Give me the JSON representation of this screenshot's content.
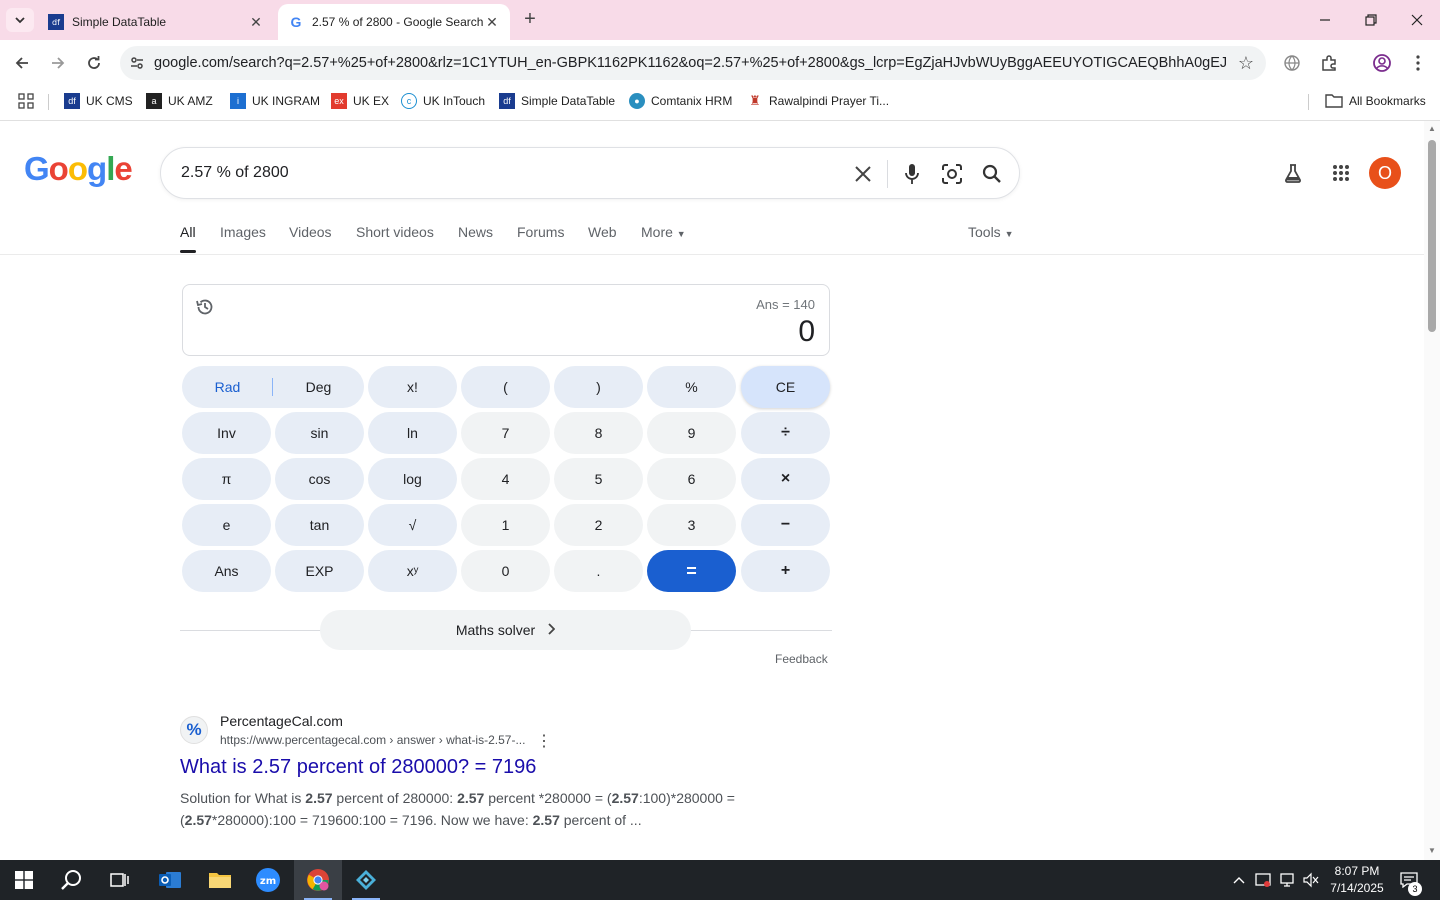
{
  "browser": {
    "tabs": [
      {
        "title": "Simple DataTable",
        "active": false,
        "favicon": "df-icon"
      },
      {
        "title": "2.57 % of 2800 - Google Search",
        "active": true,
        "favicon": "google-icon"
      }
    ],
    "url": "google.com/search?q=2.57+%25+of+2800&rlz=1C1YTUH_en-GBPK1162PK1162&oq=2.57+%25+of+2800&gs_lcrp=EgZjaHJvbWUyBggAEEUYOTIGCAEQBhhA0gEJMjgyM...",
    "bookmarks": [
      "UK CMS",
      "UK AMZ",
      "UK INGRAM",
      "UK EX",
      "UK InTouch",
      "Simple DataTable",
      "Comtanix HRM",
      "Rawalpindi Prayer Ti..."
    ],
    "all_bookmarks": "All Bookmarks"
  },
  "google": {
    "logo": [
      "G",
      "o",
      "o",
      "g",
      "l",
      "e"
    ],
    "query": "2.57 % of 2800",
    "avatar_letter": "O",
    "tabs": [
      "All",
      "Images",
      "Videos",
      "Short videos",
      "News",
      "Forums",
      "Web",
      "More"
    ],
    "tools": "Tools"
  },
  "calculator": {
    "ans": "Ans = 140",
    "value": "0",
    "rad": "Rad",
    "deg": "Deg",
    "keys": [
      [
        "x!",
        "(",
        ")",
        "%",
        "CE"
      ],
      [
        "Inv",
        "sin",
        "ln",
        "7",
        "8",
        "9",
        "÷"
      ],
      [
        "π",
        "cos",
        "log",
        "4",
        "5",
        "6",
        "×"
      ],
      [
        "e",
        "tan",
        "√",
        "1",
        "2",
        "3",
        "−"
      ],
      [
        "Ans",
        "EXP",
        "xʸ",
        "0",
        ".",
        "=",
        "+"
      ]
    ],
    "solver": "Maths solver",
    "feedback": "Feedback"
  },
  "result": {
    "site": "PercentageCal.com",
    "url": "https://www.percentagecal.com › answer › what-is-2.57-...",
    "title": "What is 2.57 percent of 280000? = 7196",
    "snippet_parts": [
      "Solution for What is ",
      "2.57",
      " percent of 280000: ",
      "2.57",
      " percent *280000 = (",
      "2.57",
      ":100)*280000 = (",
      "2.57",
      "*280000):100 = 719600:100 = 7196. Now we have: ",
      "2.57",
      " percent of ..."
    ]
  },
  "taskbar": {
    "time": "8:07 PM",
    "date": "7/14/2025",
    "notifications": "3"
  },
  "colors": {
    "tabstrip": "#f8dbe8",
    "google_blue": "#4285f4",
    "google_red": "#ea4335",
    "google_yellow": "#fbbc05",
    "google_green": "#34a853",
    "equals_key": "#1a5fd0",
    "link": "#1a0dab"
  }
}
